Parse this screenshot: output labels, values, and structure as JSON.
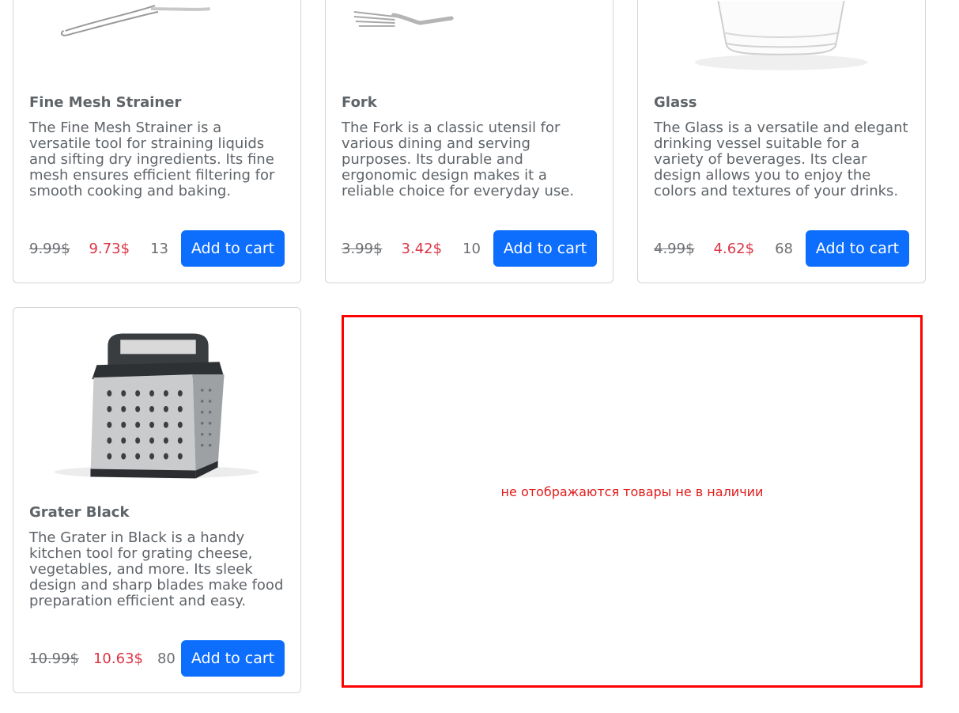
{
  "products": [
    {
      "name": "Fine Mesh Strainer",
      "description": "The Fine Mesh Strainer is a versatile tool for straining liquids and sifting dry ingredients. Its fine mesh ensures efficient filtering for smooth cooking and baking.",
      "old_price": "9.99$",
      "new_price": "9.73$",
      "stock": "13",
      "button_label": "Add to cart",
      "image_icon": "strainer-image"
    },
    {
      "name": "Fork",
      "description": "The Fork is a classic utensil for various dining and serving purposes. Its durable and ergonomic design makes it a reliable choice for everyday use.",
      "old_price": "3.99$",
      "new_price": "3.42$",
      "stock": "10",
      "button_label": "Add to cart",
      "image_icon": "fork-image"
    },
    {
      "name": "Glass",
      "description": "The Glass is a versatile and elegant drinking vessel suitable for a variety of beverages. Its clear design allows you to enjoy the colors and textures of your drinks.",
      "old_price": "4.99$",
      "new_price": "4.62$",
      "stock": "68",
      "button_label": "Add to cart",
      "image_icon": "glass-image"
    },
    {
      "name": "Grater Black",
      "description": "The Grater in Black is a handy kitchen tool for grating cheese, vegetables, and more. Its sleek design and sharp blades make food preparation efficient and easy.",
      "old_price": "10.99$",
      "new_price": "10.63$",
      "stock": "80",
      "button_label": "Add to cart",
      "image_icon": "grater-image"
    }
  ],
  "annotation": {
    "text": "не отображаются товары не в наличии",
    "color": "#ff0000"
  },
  "colors": {
    "primary_button": "#0d6efd",
    "sale_price": "#dc3545"
  }
}
